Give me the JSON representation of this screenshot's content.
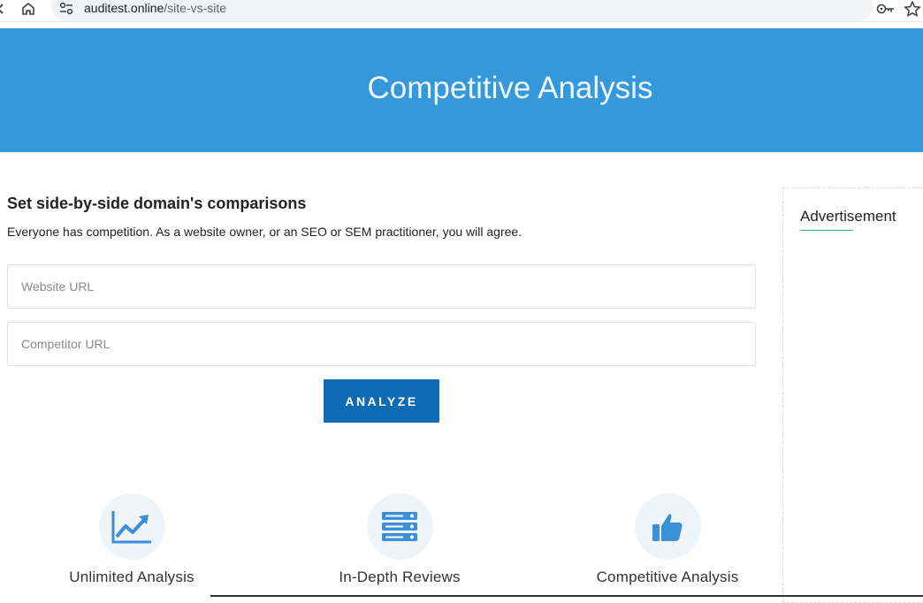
{
  "browser": {
    "url_domain": "auditest.online",
    "url_path": "/site-vs-site"
  },
  "hero": {
    "title": "Competitive Analysis"
  },
  "main": {
    "heading": "Set side-by-side domain's comparisons",
    "description": "Everyone has competition. As a website owner, or an SEO or SEM practitioner, you will agree.",
    "website_placeholder": "Website URL",
    "competitor_placeholder": "Competitor URL",
    "analyze_label": "ANALYZE"
  },
  "features": [
    {
      "label": "Unlimited Analysis",
      "icon": "trending-chart-icon"
    },
    {
      "label": "In-Depth Reviews",
      "icon": "server-stack-icon"
    },
    {
      "label": "Competitive Analysis",
      "icon": "thumbs-up-icon"
    }
  ],
  "sidebar": {
    "ad_title": "Advertisement"
  },
  "colors": {
    "hero_bg": "#3498db",
    "button_bg": "#0f6ab4",
    "icon_blue": "#3a8fd6",
    "ad_underline": "#3cb371"
  }
}
